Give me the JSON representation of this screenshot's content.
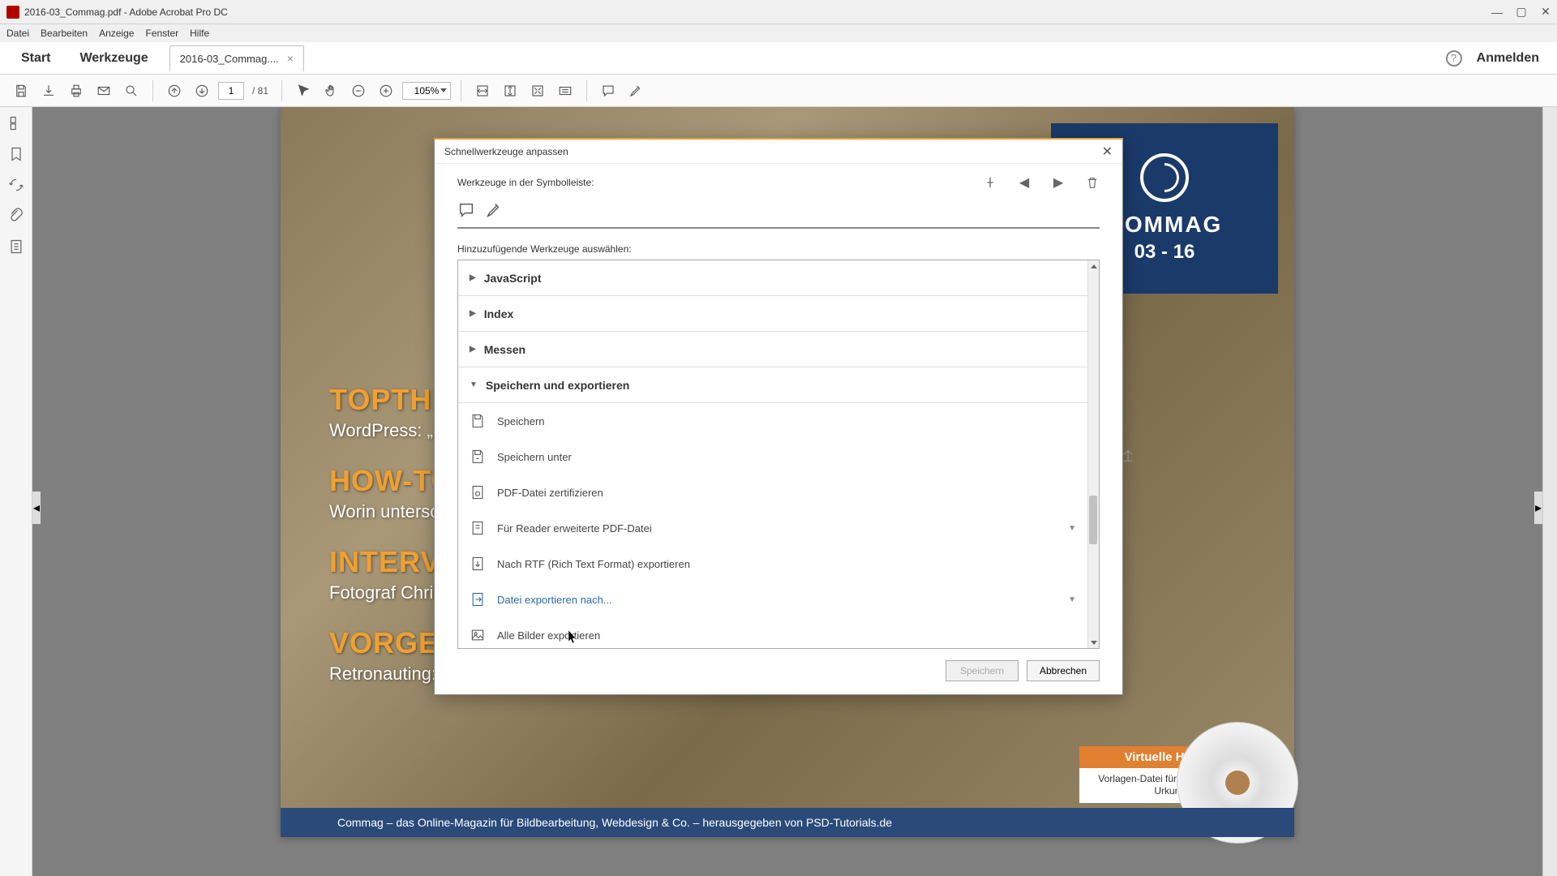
{
  "titlebar": {
    "text": "2016-03_Commag.pdf - Adobe Acrobat Pro DC"
  },
  "menubar": {
    "items": [
      "Datei",
      "Bearbeiten",
      "Anzeige",
      "Fenster",
      "Hilfe"
    ]
  },
  "tabs": {
    "start": "Start",
    "tools": "Werkzeuge",
    "doc": "2016-03_Commag....",
    "signin": "Anmelden"
  },
  "toolbar": {
    "page_current": "1",
    "page_total": "/ 81",
    "zoom": "105%"
  },
  "doc": {
    "banner_line1": "COMMAG",
    "banner_line2": "03 - 16",
    "sections": [
      {
        "title": "TOPTHEMA",
        "sub": "WordPress: „M…"
      },
      {
        "title": "HOW-TO",
        "sub": "Worin untersc…"
      },
      {
        "title": "INTERVIEW",
        "sub": "Fotograf Chri…"
      },
      {
        "title": "VORGESTELLT",
        "sub": "Retronauting: Zurück in die Gegenwart"
      }
    ],
    "cd_label": "Virtuelle Heft-CD",
    "cd_sub": "Vorlagen-Datei für eine historische Urkunde",
    "footer": "Commag – das Online-Magazin für Bildbearbeitung, Webdesign & Co. – herausgegeben von PSD-Tutorials.de"
  },
  "dialog": {
    "title": "Schnellwerkzeuge anpassen",
    "label_current": "Werkzeuge in der Symbolleiste:",
    "label_add": "Hinzuzufügende Werkzeuge auswählen:",
    "categories": [
      {
        "name": "JavaScript",
        "expanded": false
      },
      {
        "name": "Index",
        "expanded": false
      },
      {
        "name": "Messen",
        "expanded": false
      },
      {
        "name": "Speichern und exportieren",
        "expanded": true
      }
    ],
    "items": [
      {
        "label": "Speichern",
        "icon": "save",
        "dropdown": false
      },
      {
        "label": "Speichern unter",
        "icon": "save-as",
        "dropdown": false
      },
      {
        "label": "PDF-Datei zertifizieren",
        "icon": "certify",
        "dropdown": false
      },
      {
        "label": "Für Reader erweiterte PDF-Datei",
        "icon": "reader",
        "dropdown": true
      },
      {
        "label": "Nach RTF (Rich Text Format) exportieren",
        "icon": "export-rtf",
        "dropdown": false
      },
      {
        "label": "Datei exportieren nach...",
        "icon": "export",
        "dropdown": true,
        "selected": true
      },
      {
        "label": "Alle Bilder exportieren",
        "icon": "export-images",
        "dropdown": false
      }
    ],
    "btn_save": "Speichern",
    "btn_cancel": "Abbrechen"
  }
}
